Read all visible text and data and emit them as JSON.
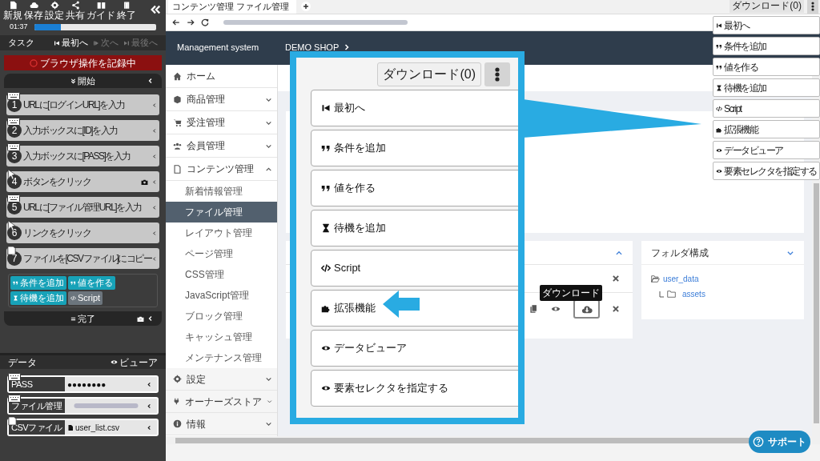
{
  "recorder": {
    "tools": [
      {
        "label": "新規"
      },
      {
        "label": "保存"
      },
      {
        "label": "設定"
      },
      {
        "label": "共有"
      },
      {
        "label": "ガイド"
      },
      {
        "label": "終了"
      }
    ],
    "timer": "01:37",
    "progress": {
      "level": 0.22
    },
    "task": {
      "title": "タスク",
      "nav": [
        {
          "label": "最初へ",
          "disabled": false
        },
        {
          "label": "次へ",
          "disabled": true
        },
        {
          "label": "最後へ",
          "disabled": true
        }
      ]
    },
    "recording": "ブラウザ操作を記録中",
    "start": "開始",
    "steps": [
      {
        "number": "1",
        "label": "URLに[ログインURL]を入力",
        "kind": "input",
        "camera": false
      },
      {
        "number": "2",
        "label": "入力ボックスに[ID]を入力",
        "kind": "input",
        "camera": false
      },
      {
        "number": "3",
        "label": "入力ボックスに[PASS]を入力",
        "kind": "input",
        "camera": false
      },
      {
        "number": "4",
        "label": "ボタンをクリック",
        "kind": "click",
        "camera": true
      },
      {
        "number": "5",
        "label": "URLに[ファイル管理URL]を入力",
        "kind": "input",
        "camera": false
      },
      {
        "number": "6",
        "label": "リンクをクリック",
        "kind": "click",
        "camera": false
      },
      {
        "number": "7",
        "label": "ファイルを[CSVファイル]にコピー",
        "kind": "copy",
        "camera": false
      }
    ],
    "actions": [
      {
        "label": "条件を追加",
        "kind": "condition"
      },
      {
        "label": "値を作る",
        "kind": "value"
      },
      {
        "label": "待機を追加",
        "kind": "wait"
      },
      {
        "label": "Script",
        "kind": "script"
      }
    ],
    "finish": "完了"
  },
  "data": {
    "title": "データ",
    "viewer": "ビューア",
    "rows": [
      {
        "label": "PASS",
        "value": "●●●●●●●●",
        "kind": "input"
      },
      {
        "label": "ファイル管理",
        "kind": "input"
      },
      {
        "label": "CSVファイル",
        "value": "user_list.csv",
        "kind": "copy"
      }
    ]
  },
  "browser": {
    "tab": "コンテンツ管理 ファイル管理",
    "download": "ダウンロード(0)"
  },
  "app": {
    "brand": "Management system",
    "shop": "DEMO SHOP"
  },
  "nav": [
    {
      "label": "ホーム",
      "kind": "link"
    },
    {
      "label": "商品管理",
      "kind": "group",
      "expanded": false
    },
    {
      "label": "受注管理",
      "kind": "group",
      "expanded": false
    },
    {
      "label": "会員管理",
      "kind": "group",
      "expanded": false
    },
    {
      "label": "コンテンツ管理",
      "kind": "group",
      "expanded": true,
      "children": [
        {
          "label": "新着情報管理",
          "selected": false
        },
        {
          "label": "ファイル管理",
          "selected": true
        },
        {
          "label": "レイアウト管理",
          "selected": false
        },
        {
          "label": "ページ管理",
          "selected": false
        },
        {
          "label": "CSS管理",
          "selected": false
        },
        {
          "label": "JavaScript管理",
          "selected": false
        },
        {
          "label": "ブロック管理",
          "selected": false
        },
        {
          "label": "キャッシュ管理",
          "selected": false
        },
        {
          "label": "メンテナンス管理",
          "selected": false
        }
      ]
    },
    {
      "label": "設定",
      "kind": "group",
      "expanded": false
    },
    {
      "label": "オーナーズストア",
      "kind": "group",
      "expanded": false
    },
    {
      "label": "情報",
      "kind": "group",
      "expanded": false
    }
  ],
  "page": {
    "tooltip": "ダウンロード"
  },
  "folder_panel": {
    "title": "フォルダ構成",
    "tree": [
      {
        "label": "user_data",
        "children": [
          {
            "label": "assets"
          }
        ]
      }
    ]
  },
  "menu": {
    "items": [
      {
        "label": "最初へ",
        "kind": "first"
      },
      {
        "label": "条件を追加",
        "kind": "condition"
      },
      {
        "label": "値を作る",
        "kind": "value"
      },
      {
        "label": "待機を追加",
        "kind": "wait"
      },
      {
        "label": "Script",
        "kind": "script"
      },
      {
        "label": "拡張機能",
        "kind": "extension"
      },
      {
        "label": "データビューア",
        "kind": "viewer"
      },
      {
        "label": "要素セレクタを指定する",
        "kind": "selector"
      }
    ]
  },
  "callout": {
    "download": "ダウンロード(0)",
    "items": [
      {
        "label": "最初へ",
        "kind": "first"
      },
      {
        "label": "条件を追加",
        "kind": "condition"
      },
      {
        "label": "値を作る",
        "kind": "value"
      },
      {
        "label": "待機を追加",
        "kind": "wait"
      },
      {
        "label": "Script",
        "kind": "script"
      },
      {
        "label": "拡張機能",
        "kind": "extension"
      },
      {
        "label": "データビューア",
        "kind": "viewer"
      },
      {
        "label": "要素セレクタを指定する",
        "kind": "selector"
      }
    ]
  },
  "support": "サポート"
}
